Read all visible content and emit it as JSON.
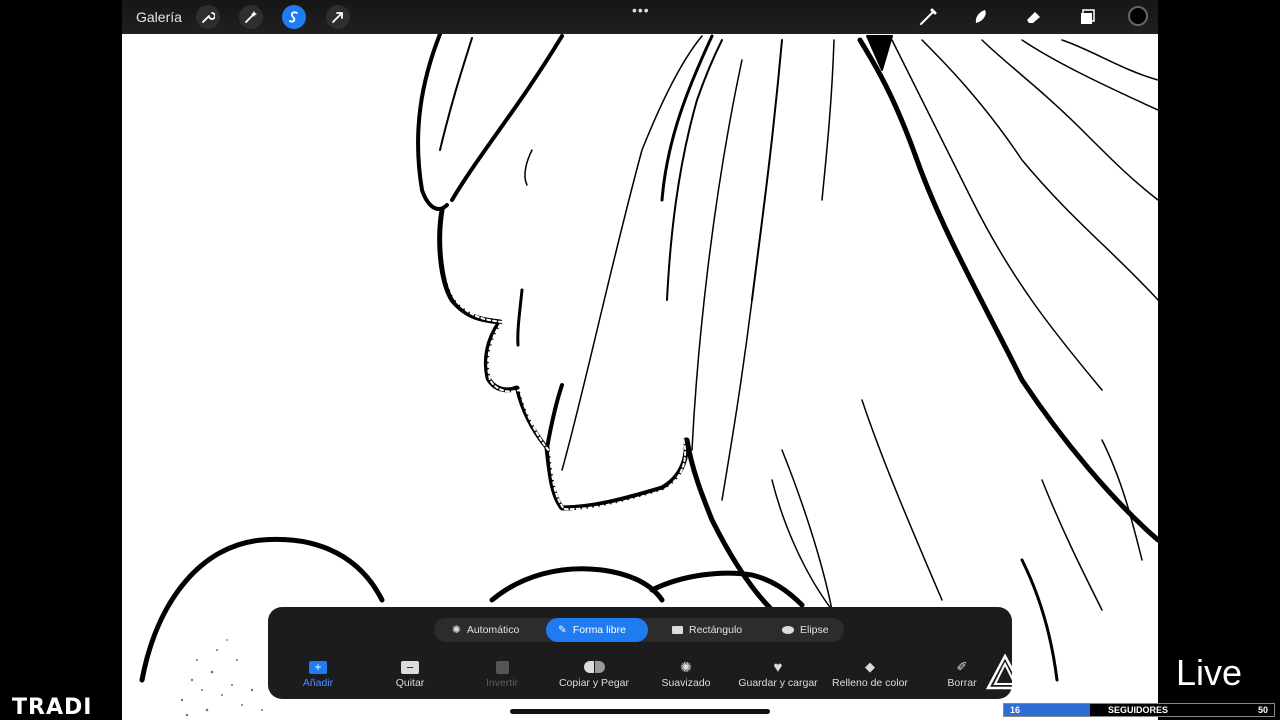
{
  "topbar": {
    "gallery_label": "Galería",
    "left_tools": [
      {
        "name": "wrench-icon",
        "active": false
      },
      {
        "name": "magic-wand-icon",
        "active": false
      },
      {
        "name": "selection-icon",
        "active": true
      },
      {
        "name": "arrow-transform-icon",
        "active": false
      }
    ],
    "right_tools": [
      "brush-icon",
      "smudge-icon",
      "eraser-icon",
      "layers-icon"
    ],
    "current_color": "#000000"
  },
  "selection_panel": {
    "modes": [
      {
        "label": "Automático",
        "icon": "sparkle-icon",
        "active": false
      },
      {
        "label": "Forma libre",
        "icon": "pen-icon",
        "active": true
      },
      {
        "label": "Rectángulo",
        "icon": "rectangle-icon",
        "active": false
      },
      {
        "label": "Elipse",
        "icon": "ellipse-icon",
        "active": false
      }
    ],
    "tools": [
      {
        "label": "Añadir",
        "icon": "add-icon",
        "state": "active"
      },
      {
        "label": "Quitar",
        "icon": "remove-icon",
        "state": "normal"
      },
      {
        "label": "Invertir",
        "icon": "invert-icon",
        "state": "disabled"
      },
      {
        "label": "Copiar y Pegar",
        "icon": "copy-paste-icon",
        "state": "normal"
      },
      {
        "label": "Suavizado",
        "icon": "feather-icon",
        "state": "normal"
      },
      {
        "label": "Guardar y cargar",
        "icon": "heart-icon",
        "state": "normal"
      },
      {
        "label": "Relleno de color",
        "icon": "fill-icon",
        "state": "normal"
      },
      {
        "label": "Borrar",
        "icon": "clear-icon",
        "state": "normal"
      }
    ]
  },
  "overlay": {
    "channel_text": "TRADI",
    "live_text": "Live",
    "followers_current": "16",
    "followers_label": "SEGUIDORES",
    "followers_goal": "50",
    "followers_progress": 0.32
  },
  "colors": {
    "accent": "#1e7cf0",
    "panel": "#1c1c1e",
    "progress": "#2d6cd6"
  }
}
